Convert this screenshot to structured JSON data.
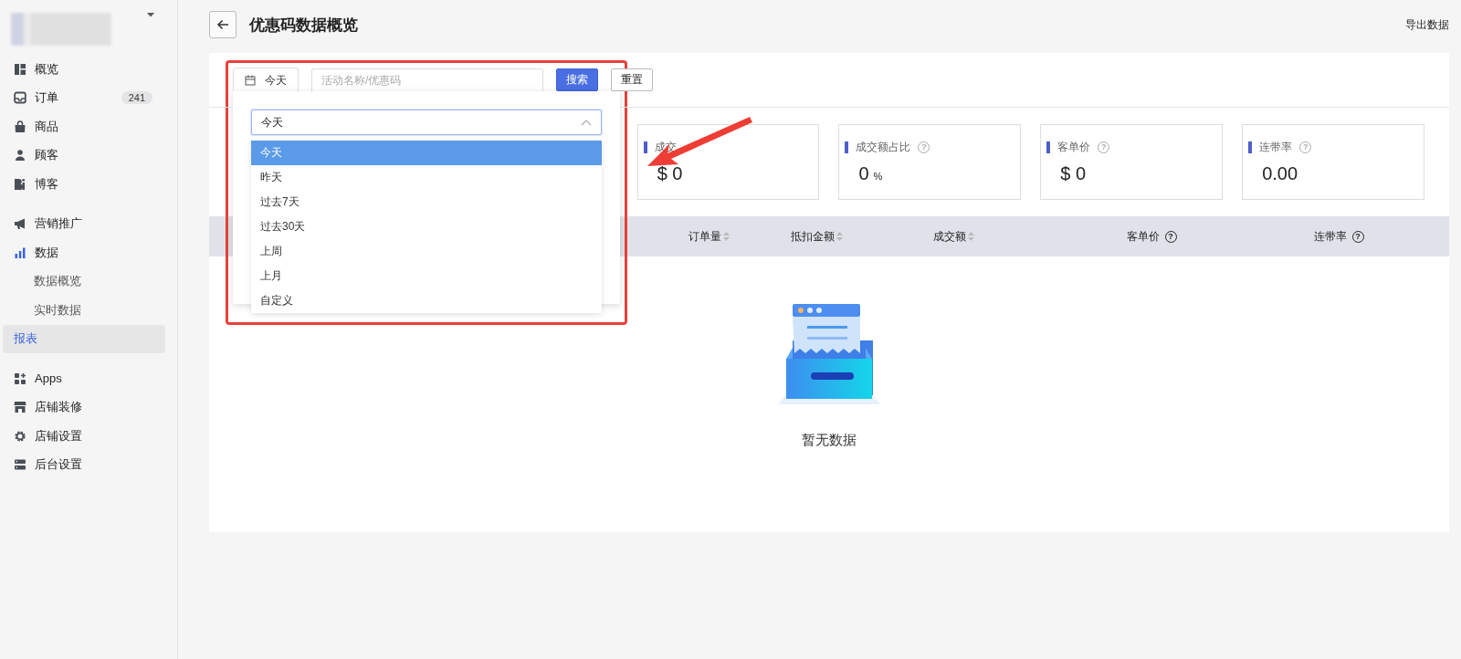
{
  "sidebar": {
    "groups": [
      {
        "items": [
          {
            "label": "概览",
            "selected": false
          },
          {
            "label": "订单",
            "badge": "241",
            "selected": false
          },
          {
            "label": "商品",
            "selected": false
          },
          {
            "label": "顾客",
            "selected": false
          },
          {
            "label": "博客",
            "selected": false
          }
        ]
      },
      {
        "items": [
          {
            "label": "营销推广",
            "selected": false
          },
          {
            "label": "数据",
            "selected": false,
            "expanded": true,
            "children": [
              {
                "label": "数据概览",
                "selected": false
              },
              {
                "label": "实时数据",
                "selected": false
              },
              {
                "label": "报表",
                "selected": true
              }
            ]
          }
        ]
      },
      {
        "items": [
          {
            "label": "Apps",
            "selected": false
          },
          {
            "label": "店铺装修",
            "selected": false
          },
          {
            "label": "店铺设置",
            "selected": false
          },
          {
            "label": "后台设置",
            "selected": false
          }
        ]
      }
    ]
  },
  "header": {
    "title": "优惠码数据概览",
    "export_link": "导出数据"
  },
  "filter": {
    "date_button": "今天",
    "search": {
      "placeholder": "活动名称/优惠码"
    },
    "search_button": "搜索",
    "reset_button": "重置"
  },
  "date_dropdown": {
    "expanded": true,
    "value": "今天",
    "options": [
      {
        "label": "今天",
        "selected": true
      },
      {
        "label": "昨天",
        "selected": false
      },
      {
        "label": "过去7天",
        "selected": false
      },
      {
        "label": "过去30天",
        "selected": false
      },
      {
        "label": "上周",
        "selected": false
      },
      {
        "label": "上月",
        "selected": false
      },
      {
        "label": "自定义",
        "selected": false
      }
    ]
  },
  "stats": [
    {
      "label": "成交",
      "value": "$ 0"
    },
    {
      "label": "成交额占比",
      "value": "0",
      "unit": "%",
      "help": "?"
    },
    {
      "label": "客单价",
      "value": "$ 0",
      "help": "?"
    },
    {
      "label": "连带率",
      "value": "0.00",
      "help": "?"
    }
  ],
  "table": {
    "columns": [
      {
        "label": "订单量",
        "sortable": true
      },
      {
        "label": "抵扣金额",
        "sortable": true
      },
      {
        "label": "成交额",
        "sortable": true
      },
      {
        "label": "客单价",
        "sortable": false,
        "help": "?"
      },
      {
        "label": "连带率",
        "sortable": false,
        "help": "?"
      }
    ],
    "empty_text": "暂无数据"
  }
}
